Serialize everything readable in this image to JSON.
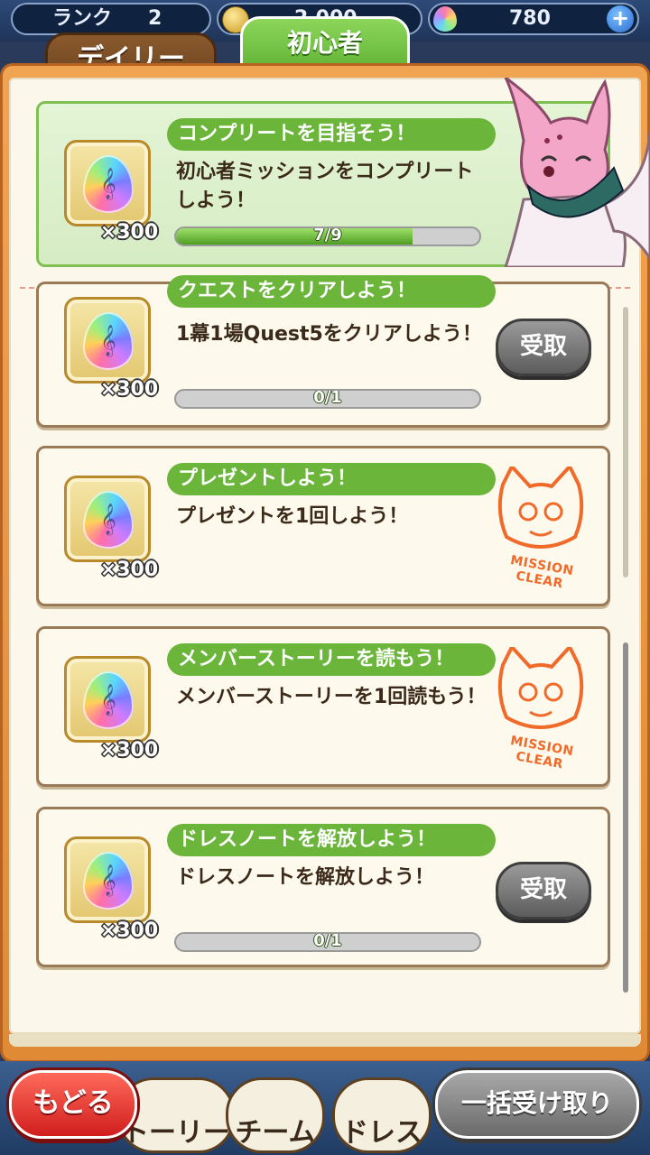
{
  "status_bar": {
    "rank_label": "ランク",
    "rank_value": "2",
    "coins": "2,000",
    "gems": "780",
    "plus_icon": "+"
  },
  "tabs": [
    {
      "label": "デイリー",
      "active": false
    },
    {
      "label": "初心者",
      "active": true
    }
  ],
  "featured": {
    "title": "コンプリートを目指そう！",
    "description": "初心者ミッションをコンプリートしよう！",
    "reward_icon": "rainbow-gem-icon",
    "reward_count": "×300",
    "progress_text": "7/9",
    "progress_value": 0.78
  },
  "missions": [
    {
      "title": "クエストをクリアしよう！",
      "description": "1幕1場Quest5をクリアしよう！",
      "reward_count": "×300",
      "progress_text": "0/1",
      "progress_value": 0,
      "state": "receive",
      "button_label": "受取"
    },
    {
      "title": "プレゼントしよう！",
      "description": "プレゼントを1回しよう！",
      "reward_count": "×300",
      "state": "cleared",
      "stamp_text": "MISSION CLEAR"
    },
    {
      "title": "メンバーストーリーを読もう！",
      "description": "メンバーストーリーを1回読もう！",
      "reward_count": "×300",
      "state": "cleared",
      "stamp_text": "MISSION CLEAR"
    },
    {
      "title": "ドレスノートを解放しよう！",
      "description": "ドレスノートを解放しよう！",
      "reward_count": "×300",
      "progress_text": "0/1",
      "progress_value": 0,
      "state": "receive",
      "button_label": "受取"
    }
  ],
  "bottom_nav": {
    "back_label": "もどる",
    "items": [
      "トーリー",
      "チーム",
      "ドレス"
    ],
    "bulk_label": "一括受け取り"
  },
  "colors": {
    "accent_green": "#6ab53a",
    "frame_orange": "#e08a36",
    "stamp_orange": "#f06a2a"
  }
}
